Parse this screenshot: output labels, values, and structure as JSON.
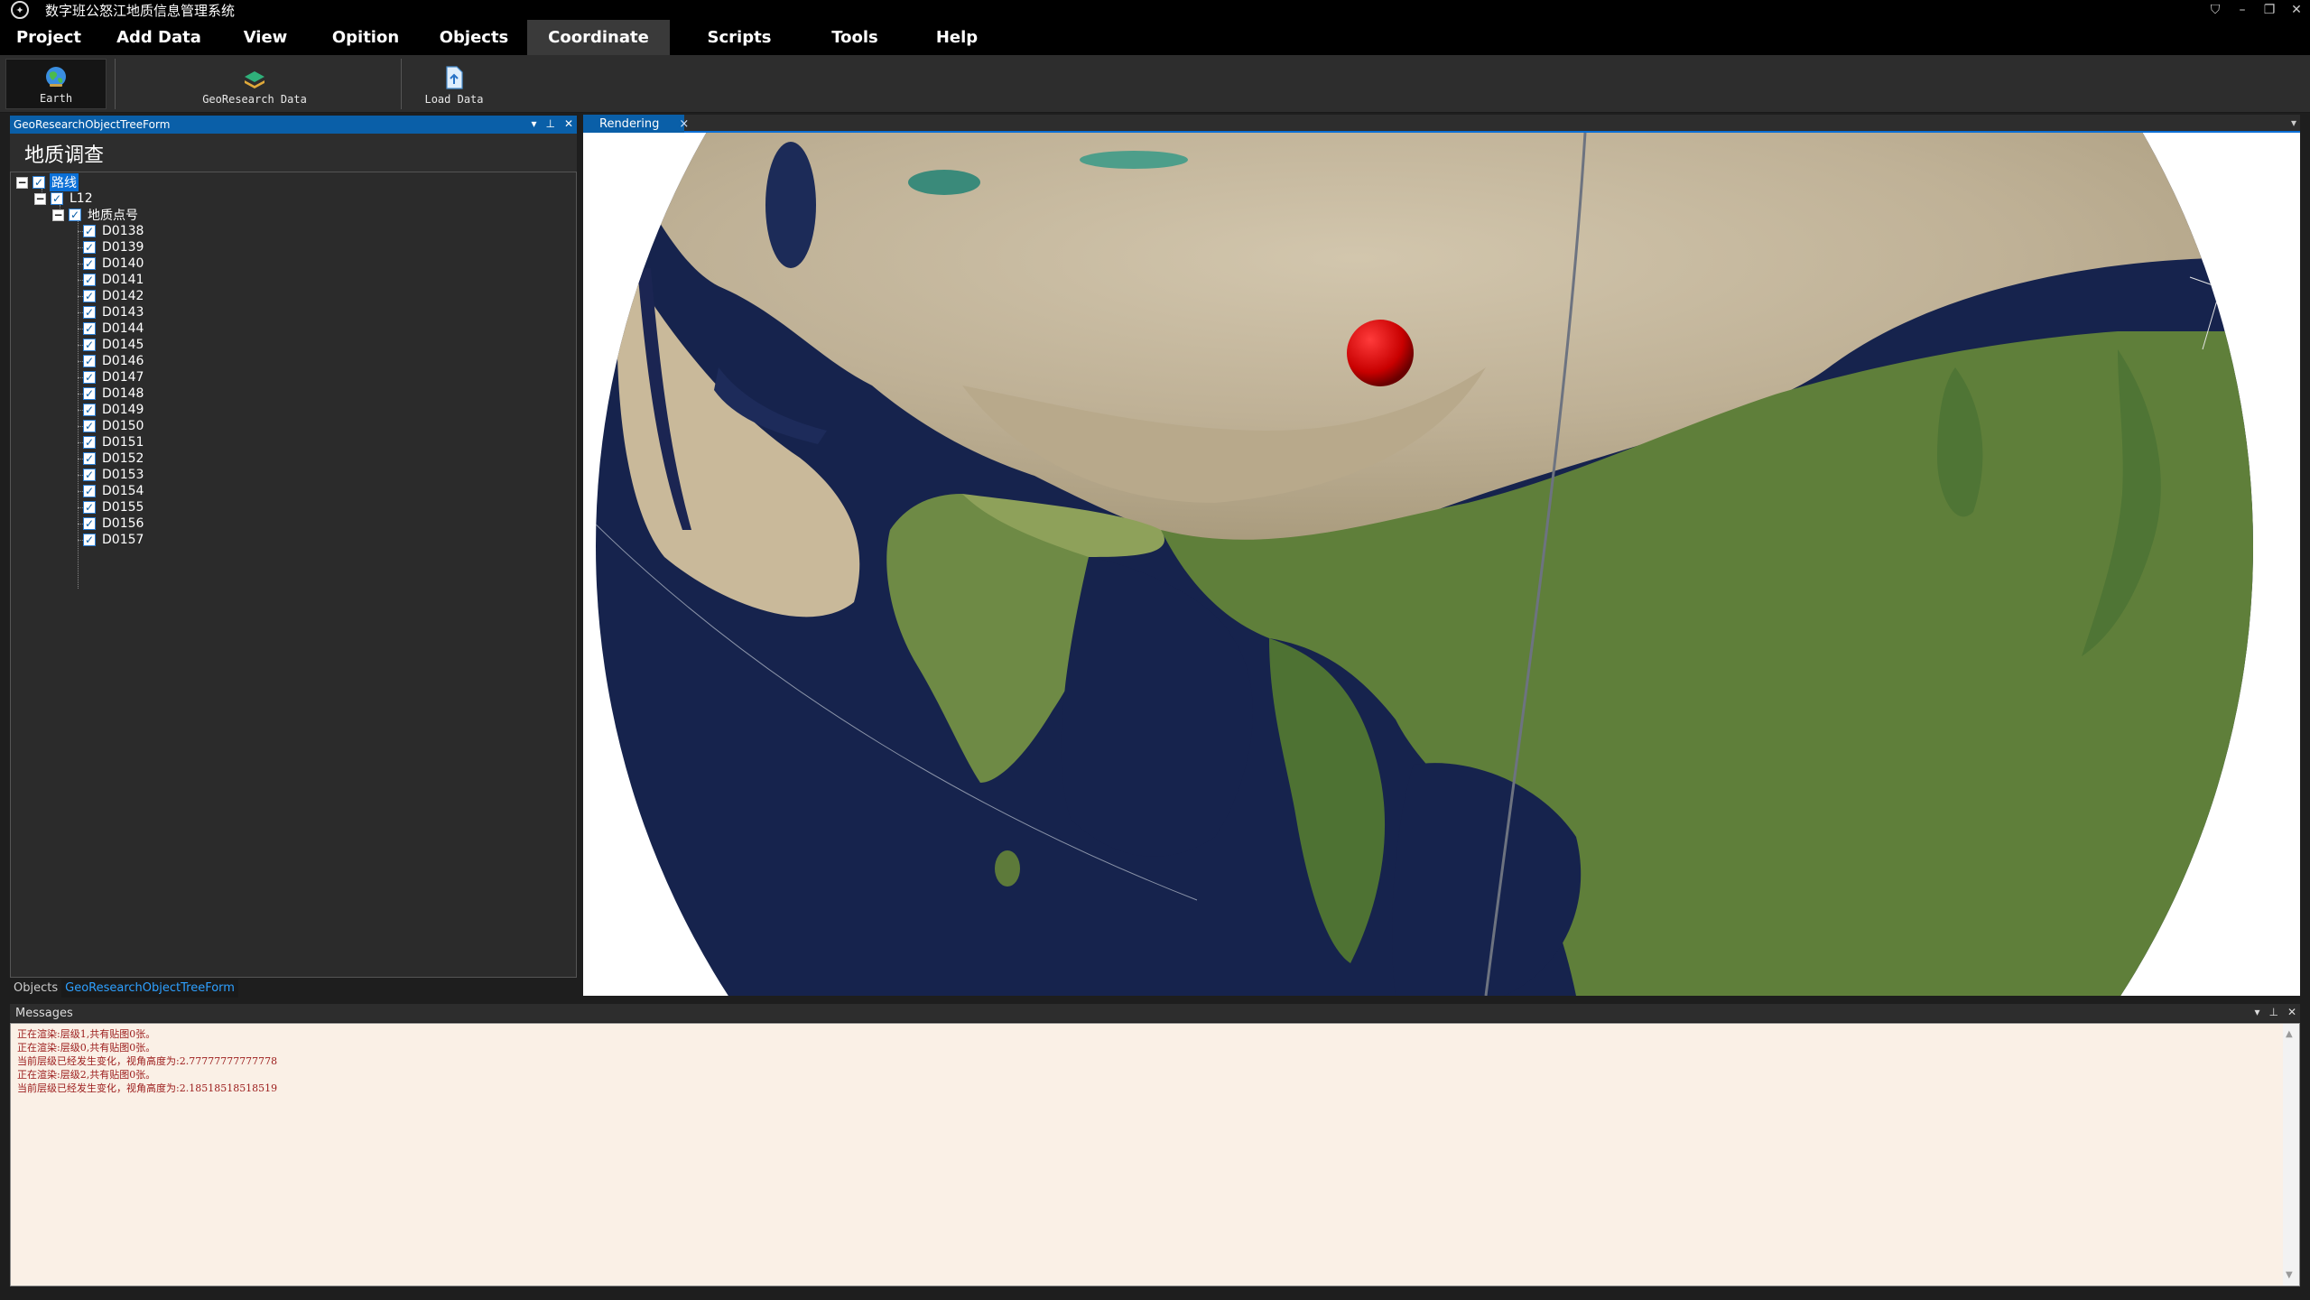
{
  "window": {
    "title": "数字班公怒江地质信息管理系统",
    "logo_icon": "app-logo-icon",
    "controls": [
      "⛉",
      "–",
      "❐",
      "✕"
    ]
  },
  "menu": {
    "items": [
      {
        "label": "Project"
      },
      {
        "label": "Add Data"
      },
      {
        "label": "View"
      },
      {
        "label": "Opition"
      },
      {
        "label": "Objects"
      },
      {
        "label": "Coordinate",
        "active": true
      },
      {
        "label": "Scripts"
      },
      {
        "label": "Tools"
      },
      {
        "label": "Help"
      }
    ]
  },
  "ribbon": {
    "earth_label": "Earth",
    "georesearch_label": "GeoResearch Data",
    "load_label": "Load Data"
  },
  "left_panel": {
    "header": "GeoResearchObjectTreeForm",
    "title": "地质调查",
    "tree": {
      "root": "路线",
      "line": "L12",
      "group": "地质点号",
      "points": [
        "D0138",
        "D0139",
        "D0140",
        "D0141",
        "D0142",
        "D0143",
        "D0144",
        "D0145",
        "D0146",
        "D0147",
        "D0148",
        "D0149",
        "D0150",
        "D0151",
        "D0152",
        "D0153",
        "D0154",
        "D0155",
        "D0156",
        "D0157"
      ]
    },
    "tabs": [
      "Objects",
      "GeoResearchObjectTreeForm"
    ]
  },
  "render": {
    "tab_label": "Rendering",
    "close_glyph": "×"
  },
  "messages": {
    "header": "Messages",
    "lines": [
      "正在渲染:层级1,共有贴图0张。",
      "正在渲染:层级0,共有贴图0张。",
      "当前层级已经发生变化，视角高度为:2.77777777777778",
      "正在渲染:层级2,共有贴图0张。",
      "当前层级已经发生变化，视角高度为:2.18518518518519"
    ]
  },
  "colors": {
    "accent": "#0a5fa8",
    "marker": "#d40000",
    "message_text": "#9b1b1b",
    "message_bg": "#faf0e6"
  }
}
